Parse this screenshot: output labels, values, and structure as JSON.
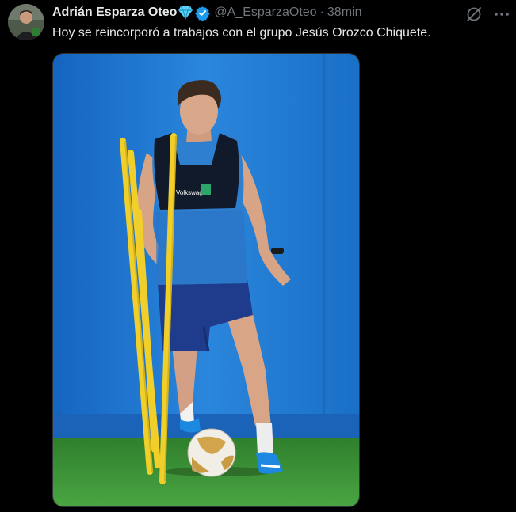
{
  "tweet": {
    "author_name": "Adrián Esparza Oteo",
    "handle": "@A_EsparzaOteo",
    "separator": "·",
    "time": "38min",
    "text": "Hoy se reincorporó a trabajos con el grupo Jesús Orozco Chiquete.",
    "badges": [
      "diamond-icon",
      "verified-badge-icon"
    ],
    "actions": [
      "grok-icon",
      "more-icon"
    ]
  },
  "media": {
    "kind": "photo",
    "jersey_text": "Volkswagen",
    "colors": {
      "wall": "#1a78d2",
      "grass": "#3f9a3a",
      "poles": "#f1cf2a",
      "shorts": "#1f3b8c"
    }
  },
  "colors": {
    "background": "#000000",
    "text": "#e7e9ea",
    "muted": "#71767b",
    "verified": "#1d9bf0",
    "diamond": "#5ad1f5"
  }
}
